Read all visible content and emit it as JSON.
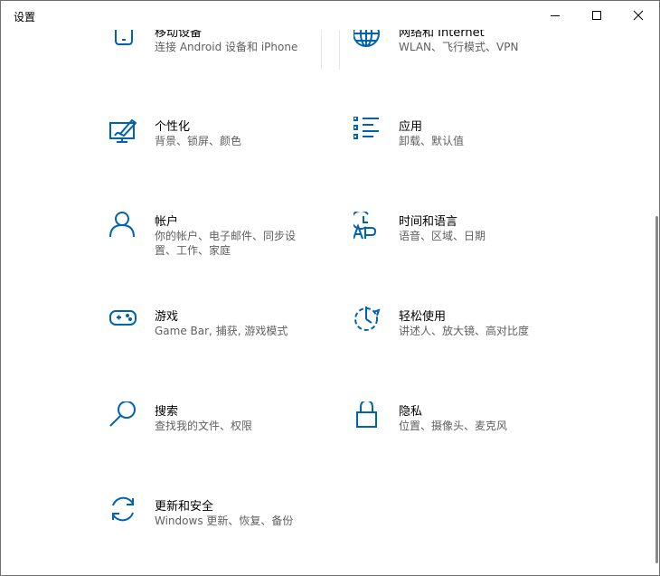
{
  "window": {
    "title": "设置"
  },
  "tiles": [
    {
      "name": "移动设备",
      "desc": "连接 Android 设备和 iPhone",
      "icon": "phone-icon"
    },
    {
      "name": "网络和 Internet",
      "desc": "WLAN、飞行模式、VPN",
      "icon": "globe-icon"
    },
    {
      "name": "个性化",
      "desc": "背景、锁屏、颜色",
      "icon": "personalization-icon"
    },
    {
      "name": "应用",
      "desc": "卸载、默认值",
      "icon": "apps-list-icon"
    },
    {
      "name": "帐户",
      "desc": "你的帐户、电子邮件、同步设置、工作、家庭",
      "icon": "person-icon"
    },
    {
      "name": "时间和语言",
      "desc": "语音、区域、日期",
      "icon": "time-language-icon"
    },
    {
      "name": "游戏",
      "desc": "Game Bar, 捕获, 游戏模式",
      "icon": "gamepad-icon"
    },
    {
      "name": "轻松使用",
      "desc": "讲述人、放大镜、高对比度",
      "icon": "ease-of-access-icon"
    },
    {
      "name": "搜索",
      "desc": "查找我的文件、权限",
      "icon": "search-icon"
    },
    {
      "name": "隐私",
      "desc": "位置、摄像头、麦克风",
      "icon": "lock-icon"
    },
    {
      "name": "更新和安全",
      "desc": "Windows 更新、恢复、备份",
      "icon": "update-icon"
    }
  ],
  "colors": {
    "accent": "#0063b1",
    "text": "#000000",
    "subtext": "#5f5f5f"
  }
}
